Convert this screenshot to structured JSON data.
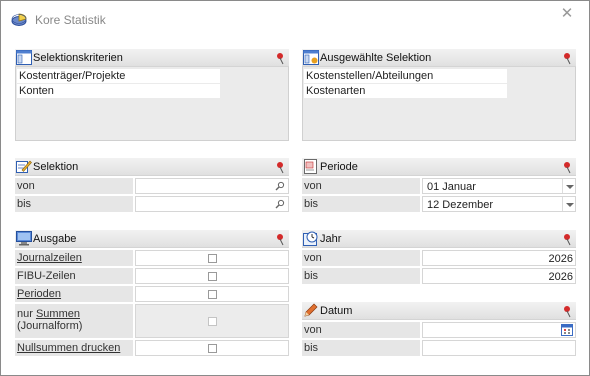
{
  "window": {
    "title": "Kore Statistik",
    "close_glyph": "✕"
  },
  "selektionskriterien": {
    "title": "Selektionskriterien",
    "items": [
      "Kostenträger/Projekte",
      "Konten"
    ]
  },
  "ausgewaehlte_selektion": {
    "title": "Ausgewählte Selektion",
    "items": [
      "Kostenstellen/Abteilungen",
      "Kostenarten"
    ]
  },
  "selektion": {
    "title": "Selektion",
    "von_label": "von",
    "bis_label": "bis",
    "von_value": "",
    "bis_value": ""
  },
  "periode": {
    "title": "Periode",
    "von_label": "von",
    "bis_label": "bis",
    "von_value": "01 Januar",
    "bis_value": "12 Dezember"
  },
  "ausgabe": {
    "title": "Ausgabe",
    "journalzeilen": {
      "label": "Journalzeilen",
      "checked": false
    },
    "fibu_zeilen": {
      "label": "FIBU-Zeilen",
      "checked": false
    },
    "perioden": {
      "label": "Perioden",
      "checked": false
    },
    "nur_summen": {
      "label_line1": "nur Summen",
      "label_line2": "(Journalform)",
      "checked": false
    },
    "nullsummen": {
      "label": "Nullsummen drucken",
      "checked": false
    }
  },
  "jahr": {
    "title": "Jahr",
    "von_label": "von",
    "bis_label": "bis",
    "von_value": "2026",
    "bis_value": "2026"
  },
  "datum": {
    "title": "Datum",
    "von_label": "von",
    "bis_label": "bis",
    "von_value": "",
    "bis_value": ""
  },
  "icons": {
    "app": "chart-disk-icon",
    "list": "list-window-icon",
    "selected_list": "selected-list-icon",
    "selektion": "edit-icon",
    "periode": "calendar-page-icon",
    "ausgabe": "monitor-icon",
    "jahr": "clock-calendar-icon",
    "datum": "pencil-icon",
    "pin": "pushpin-icon",
    "search": "magnifier-icon",
    "date_picker": "calendar-icon"
  },
  "colors": {
    "pin": "#c8202a",
    "header": "#e6e6e6"
  }
}
